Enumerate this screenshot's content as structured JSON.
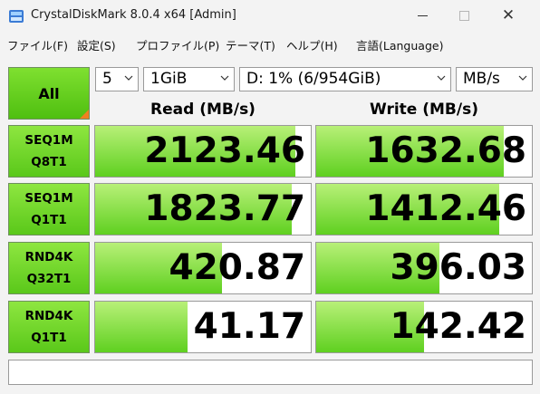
{
  "window": {
    "title": "CrystalDiskMark 8.0.4 x64 [Admin]",
    "minimize_icon": "minimize-icon",
    "maximize_icon": "maximize-icon",
    "close_symbol": "✕"
  },
  "menu": [
    {
      "label": "ファイル(F)"
    },
    {
      "label": "設定(S)"
    },
    {
      "label": "プロファイル(P)"
    },
    {
      "label": "テーマ(T)"
    },
    {
      "label": "ヘルプ(H)"
    },
    {
      "label": "言語(Language)"
    }
  ],
  "controls": {
    "all_label": "All",
    "count_value": "5",
    "size_value": "1GiB",
    "drive_value": "D: 1% (6/954GiB)",
    "unit_value": "MB/s"
  },
  "headers": {
    "read": "Read (MB/s)",
    "write": "Write (MB/s)"
  },
  "rows": [
    {
      "line1": "SEQ1M",
      "line2": "Q8T1",
      "read": "2123.46",
      "write": "1632.68",
      "read_fill": 0.93,
      "write_fill": 0.87
    },
    {
      "line1": "SEQ1M",
      "line2": "Q1T1",
      "read": "1823.77",
      "write": "1412.46",
      "read_fill": 0.91,
      "write_fill": 0.85
    },
    {
      "line1": "RND4K",
      "line2": "Q32T1",
      "read": "420.87",
      "write": "396.03",
      "read_fill": 0.59,
      "write_fill": 0.57
    },
    {
      "line1": "RND4K",
      "line2": "Q1T1",
      "read": "41.17",
      "write": "142.42",
      "read_fill": 0.43,
      "write_fill": 0.5
    }
  ],
  "comment": "",
  "colors": {
    "bar_green": "#5fd020",
    "label_green": "#5ac81a",
    "corner_orange": "#f08020"
  }
}
